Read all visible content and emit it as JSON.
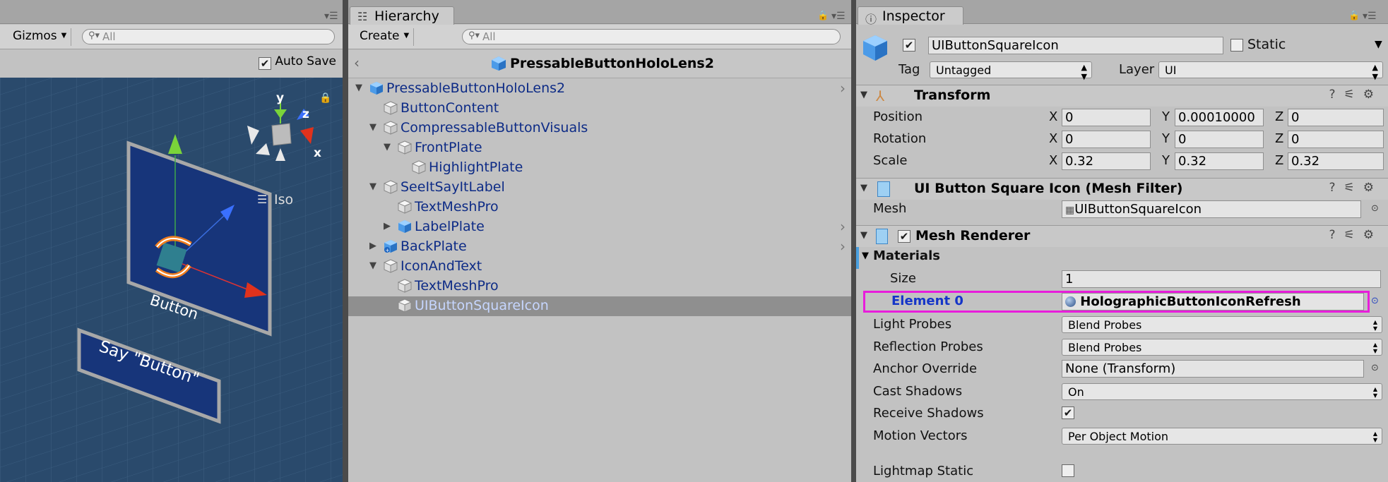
{
  "scene": {
    "toolbar": {
      "gizmos": "Gizmos",
      "search_placeholder": "All"
    },
    "autosave_label": "Auto Save",
    "autosave_checked": true,
    "view": {
      "iso_label": "Iso",
      "axis_y": "y",
      "axis_z": "z",
      "axis_x": "x",
      "button_text": "Button",
      "say_button_text": "Say \"Button\""
    }
  },
  "hierarchy": {
    "tab_label": "Hierarchy",
    "create_label": "Create",
    "search_placeholder": "All",
    "root_title": "PressableButtonHoloLens2",
    "items": [
      {
        "label": "PressableButtonHoloLens2",
        "depth": 0,
        "expanded": "open",
        "arrow": true
      },
      {
        "label": "ButtonContent",
        "depth": 1,
        "expanded": "none"
      },
      {
        "label": "CompressableButtonVisuals",
        "depth": 1,
        "expanded": "open"
      },
      {
        "label": "FrontPlate",
        "depth": 2,
        "expanded": "open"
      },
      {
        "label": "HighlightPlate",
        "depth": 3,
        "expanded": "none"
      },
      {
        "label": "SeeItSayItLabel",
        "depth": 1,
        "expanded": "open"
      },
      {
        "label": "TextMeshPro",
        "depth": 2,
        "expanded": "none"
      },
      {
        "label": "LabelPlate",
        "depth": 2,
        "expanded": "closed",
        "arrow": true
      },
      {
        "label": "BackPlate",
        "depth": 1,
        "expanded": "closed",
        "arrow": true
      },
      {
        "label": "IconAndText",
        "depth": 1,
        "expanded": "open"
      },
      {
        "label": "TextMeshPro",
        "depth": 2,
        "expanded": "none"
      },
      {
        "label": "UIButtonSquareIcon",
        "depth": 2,
        "expanded": "none",
        "selected": true
      }
    ]
  },
  "inspector": {
    "tab_label": "Inspector",
    "object_name": "UIButtonSquareIcon",
    "static_label": "Static",
    "tag_label": "Tag",
    "tag_value": "Untagged",
    "layer_label": "Layer",
    "layer_value": "UI",
    "transform": {
      "title": "Transform",
      "position_label": "Position",
      "rotation_label": "Rotation",
      "scale_label": "Scale",
      "x": "X",
      "y": "Y",
      "z": "Z",
      "position": [
        "0",
        "0.00010000",
        "0"
      ],
      "rotation": [
        "0",
        "0",
        "0"
      ],
      "scale": [
        "0.32",
        "0.32",
        "0.32"
      ]
    },
    "mesh_filter": {
      "title": "UI Button Square Icon (Mesh Filter)",
      "mesh_label": "Mesh",
      "mesh_value": "UIButtonSquareIcon"
    },
    "mesh_renderer": {
      "title": "Mesh Renderer",
      "materials_label": "Materials",
      "size_label": "Size",
      "size_value": "1",
      "element0_label": "Element 0",
      "element0_value": "HolographicButtonIconRefresh",
      "light_probes_label": "Light Probes",
      "light_probes_value": "Blend Probes",
      "reflection_probes_label": "Reflection Probes",
      "reflection_probes_value": "Blend Probes",
      "anchor_override_label": "Anchor Override",
      "anchor_override_value": "None (Transform)",
      "cast_shadows_label": "Cast Shadows",
      "cast_shadows_value": "On",
      "receive_shadows_label": "Receive Shadows",
      "receive_shadows_checked": true,
      "motion_vectors_label": "Motion Vectors",
      "motion_vectors_value": "Per Object Motion",
      "lightmap_static_label": "Lightmap Static",
      "lightmap_static_checked": false
    },
    "highlight_color": "#e81ddb"
  }
}
